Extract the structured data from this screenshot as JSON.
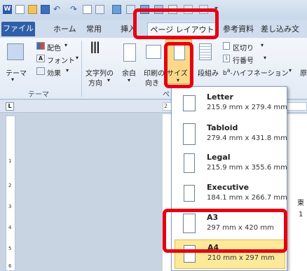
{
  "ribbon_tabs": {
    "file": "ファイル",
    "home": "ホーム",
    "common": "常用",
    "insert": "挿入",
    "page_layout": "ページ レイアウト",
    "references": "参考資料",
    "mailings": "差し込み文"
  },
  "ribbon": {
    "theme": "テーマ",
    "colors": "配色",
    "fonts": "フォント",
    "effects": "効果",
    "theme_group": "テーマ",
    "text_direction_1": "文字列の",
    "text_direction_2": "方向",
    "margins": "余白",
    "orientation_1": "印刷の",
    "orientation_2": "向き",
    "size": "サイズ",
    "columns": "段組み",
    "breaks": "区切り",
    "line_numbers": "行番号",
    "hyphenation": "ハイフネーション",
    "partial_right": "原",
    "group_letter": "ペ"
  },
  "ruler": {
    "tab_selector": "L",
    "h_mark": "2",
    "v_marks": [
      "1",
      "2",
      "3",
      "4",
      "5",
      "6"
    ]
  },
  "page_text": {
    "line1": "東",
    "line2": "1"
  },
  "size_menu": {
    "items": [
      {
        "name": "Letter",
        "dims": "215.9 mm x 279.4 mm"
      },
      {
        "name": "Tabloid",
        "dims": "279.4 mm x 431.8 mm"
      },
      {
        "name": "Legal",
        "dims": "215.9 mm x 355.6 mm"
      },
      {
        "name": "Executive",
        "dims": "184.1 mm x 266.7 mm"
      },
      {
        "name": "A3",
        "dims": "297 mm x 420 mm"
      },
      {
        "name": "A4",
        "dims": "210 mm x 297 mm"
      }
    ]
  },
  "colors": {
    "highlight": "#e60012",
    "file_tab": "#2f5fa8",
    "selected_item": "#fde99a"
  }
}
